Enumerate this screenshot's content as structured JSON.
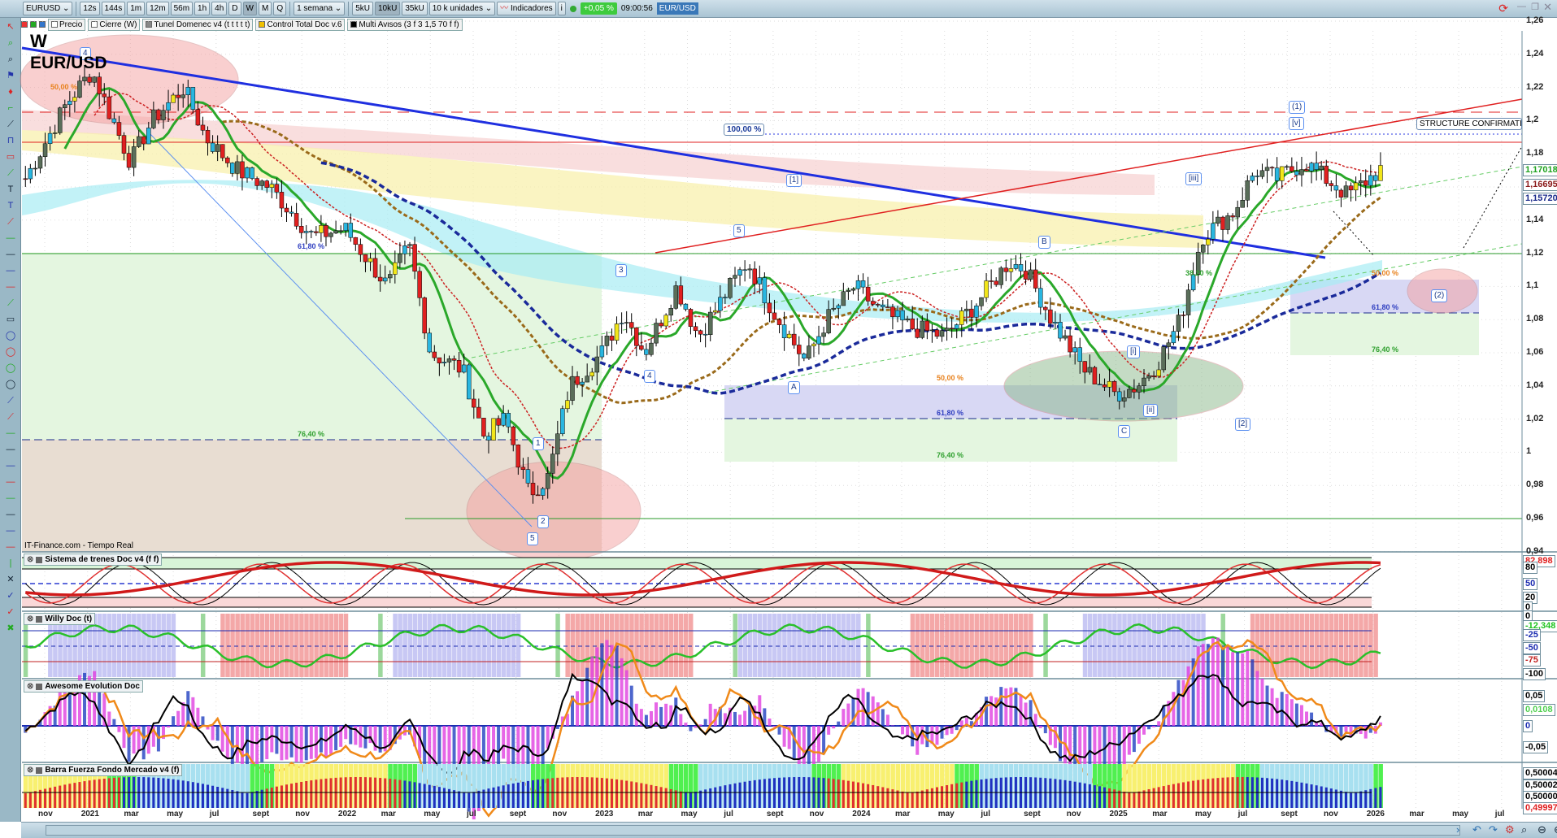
{
  "toolbar": {
    "symbol": "EURUSD",
    "intervals": [
      "12s",
      "144s",
      "1m",
      "12m",
      "56m",
      "1h",
      "4h",
      "D",
      "W",
      "M",
      "Q"
    ],
    "active_interval": "W",
    "period": "1 semana",
    "units": [
      "5kU",
      "10kU",
      "35kU"
    ],
    "active_unit": "10kU",
    "units_select": "10 k unidades",
    "indicators": "Indicadores",
    "change": "+0,05 %",
    "time": "09:00:56",
    "pair": "EUR/USD"
  },
  "legend": {
    "items": [
      "Precio",
      "Cierre (W)",
      "Tunel Domenec v4 (t t t t t)",
      "Control Total Doc v.6",
      "Multi Avisos (3 f 3 1,5 70 f f)"
    ]
  },
  "chart": {
    "title_w": "W",
    "title_pair": "EUR/USD",
    "source": "IT-Finance.com - Tiempo Real",
    "structure_label": "STRUCTURE CONFIRMATIO",
    "pct100": "100,00 %",
    "waves": [
      {
        "t": "4"
      },
      {
        "t": "(1)"
      },
      {
        "t": "[v]"
      },
      {
        "t": "[iii]"
      },
      {
        "t": "[1]"
      },
      {
        "t": "5"
      },
      {
        "t": "B"
      },
      {
        "t": "3"
      },
      {
        "t": "4"
      },
      {
        "t": "A"
      },
      {
        "t": "[i]"
      },
      {
        "t": "[ii]"
      },
      {
        "t": "C"
      },
      {
        "t": "[2]"
      },
      {
        "t": "(2)"
      },
      {
        "t": "1"
      },
      {
        "t": "2"
      },
      {
        "t": "5"
      }
    ],
    "fibs": [
      {
        "t": "50,00 %",
        "c": "#e8821e"
      },
      {
        "t": "61,80 %",
        "c": "#2f3fc0"
      },
      {
        "t": "76,40 %",
        "c": "#2fa02f"
      },
      {
        "t": "61,80 %",
        "c": "#2f3fc0"
      },
      {
        "t": "76,40 %",
        "c": "#2fa02f"
      },
      {
        "t": "50,00 %",
        "c": "#e8821e"
      },
      {
        "t": "50,00 %",
        "c": "#e8821e"
      },
      {
        "t": "61,80 %",
        "c": "#2f3fc0"
      },
      {
        "t": "76,40 %",
        "c": "#2fa02f"
      },
      {
        "t": "38,20 %",
        "c": "#2fa02f"
      }
    ]
  },
  "price_axis": {
    "ticks": [
      "1,26",
      "1,24",
      "1,22",
      "1,2",
      "1,18",
      "1,14",
      "1,12",
      "1,1",
      "1,08",
      "1,06",
      "1,04",
      "1,02",
      "1",
      "0,98",
      "0,96",
      "0,94"
    ],
    "badges": [
      {
        "v": "1,17018",
        "c": "#1fa31f"
      },
      {
        "v": "1,16695",
        "c": "#8b1a1a"
      },
      {
        "v": "1,15720",
        "c": "#1a2a8b"
      }
    ]
  },
  "price_path": [
    [
      -0.9,
      1.165
    ],
    [
      1,
      1.21
    ],
    [
      2.2,
      1.23
    ],
    [
      4,
      1.175
    ],
    [
      5,
      1.2
    ],
    [
      6.5,
      1.22
    ],
    [
      7.5,
      1.19
    ],
    [
      9,
      1.17
    ],
    [
      10.5,
      1.16
    ],
    [
      12.5,
      1.13
    ],
    [
      14,
      1.135
    ],
    [
      16,
      1.1
    ],
    [
      17,
      1.125
    ],
    [
      18,
      1.06
    ],
    [
      19.5,
      1.05
    ],
    [
      20.5,
      1.01
    ],
    [
      21.5,
      1.02
    ],
    [
      22.6,
      0.975
    ],
    [
      23.5,
      0.985
    ],
    [
      24.5,
      1.04
    ],
    [
      26,
      1.06
    ],
    [
      27,
      1.085
    ],
    [
      28,
      1.06
    ],
    [
      29.5,
      1.1
    ],
    [
      30.5,
      1.07
    ],
    [
      32,
      1.1
    ],
    [
      32.8,
      1.115
    ],
    [
      34,
      1.085
    ],
    [
      35.5,
      1.055
    ],
    [
      36.5,
      1.08
    ],
    [
      37.8,
      1.1
    ],
    [
      39,
      1.085
    ],
    [
      40.5,
      1.075
    ],
    [
      42,
      1.07
    ],
    [
      43.5,
      1.09
    ],
    [
      45,
      1.115
    ],
    [
      45.8,
      1.11
    ],
    [
      47,
      1.08
    ],
    [
      48.5,
      1.05
    ],
    [
      50,
      1.035
    ],
    [
      51,
      1.04
    ],
    [
      52,
      1.055
    ],
    [
      53,
      1.08
    ],
    [
      54,
      1.13
    ],
    [
      55.5,
      1.145
    ],
    [
      56.5,
      1.17
    ],
    [
      57.5,
      1.165
    ],
    [
      58.8,
      1.175
    ],
    [
      59.8,
      1.165
    ],
    [
      60.8,
      1.155
    ],
    [
      61.8,
      1.165
    ],
    [
      62.5,
      1.172
    ]
  ],
  "panels": [
    {
      "name": "Sistema de trenes Doc v4 (f f)",
      "ticks": [
        {
          "v": "82,898",
          "c": "#e02020"
        },
        {
          "v": "80",
          "c": "#000"
        },
        {
          "v": "50",
          "c": "#1a2ab0"
        },
        {
          "v": "20",
          "c": "#000"
        },
        {
          "v": "0",
          "c": "#000"
        }
      ]
    },
    {
      "name": "Willy Doc (t)",
      "ticks": [
        {
          "v": "0",
          "c": "#000"
        },
        {
          "v": "-12,348",
          "c": "#1fc31f"
        },
        {
          "v": "-25",
          "c": "#1a2ab0"
        },
        {
          "v": "-50",
          "c": "#1a2ab0"
        },
        {
          "v": "-75",
          "c": "#c02020"
        },
        {
          "v": "-100",
          "c": "#000"
        }
      ]
    },
    {
      "name": "Awesome Evolution Doc",
      "ticks": [
        {
          "v": "0,05",
          "c": "#000"
        },
        {
          "v": "0,0108",
          "c": "#4fd04f"
        },
        {
          "v": "0",
          "c": "#1a2ab0"
        },
        {
          "v": "-0,05",
          "c": "#000"
        }
      ]
    },
    {
      "name": "Barra Fuerza Fondo Mercado v4 (f)",
      "ticks": [
        {
          "v": "0,50004",
          "c": "#000"
        },
        {
          "v": "0,50002",
          "c": "#000"
        },
        {
          "v": "0,50000",
          "c": "#000"
        },
        {
          "v": "0,49997",
          "c": "#e02020"
        }
      ]
    }
  ],
  "time_axis": [
    "nov",
    "2021",
    "mar",
    "may",
    "jul",
    "sept",
    "nov",
    "2022",
    "mar",
    "may",
    "jul",
    "sept",
    "nov",
    "2023",
    "mar",
    "may",
    "jul",
    "sept",
    "nov",
    "2024",
    "mar",
    "may",
    "jul",
    "sept",
    "nov",
    "2025",
    "mar",
    "may",
    "jul",
    "sept",
    "nov",
    "2026",
    "mar",
    "may",
    "jul"
  ],
  "colors": {
    "up": "#5a6e5a",
    "down": "#e02020",
    "yellow": "#f2e61a",
    "cyan": "#29b6e0",
    "trend": "#1f2fe0"
  }
}
